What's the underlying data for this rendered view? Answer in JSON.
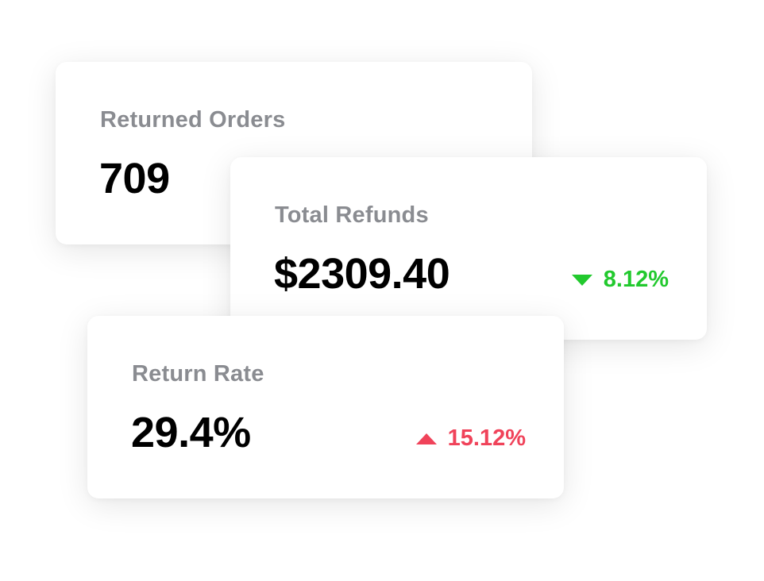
{
  "cards": {
    "returned_orders": {
      "title": "Returned Orders",
      "value": "709"
    },
    "total_refunds": {
      "title": "Total Refunds",
      "value": "$2309.40",
      "change": "8.12%",
      "change_direction": "down",
      "change_icon": "triangle-down-icon",
      "change_color": "#22c92e"
    },
    "return_rate": {
      "title": "Return Rate",
      "value": "29.4%",
      "change": "15.12%",
      "change_direction": "up",
      "change_icon": "triangle-up-icon",
      "change_color": "#f0435a"
    }
  }
}
